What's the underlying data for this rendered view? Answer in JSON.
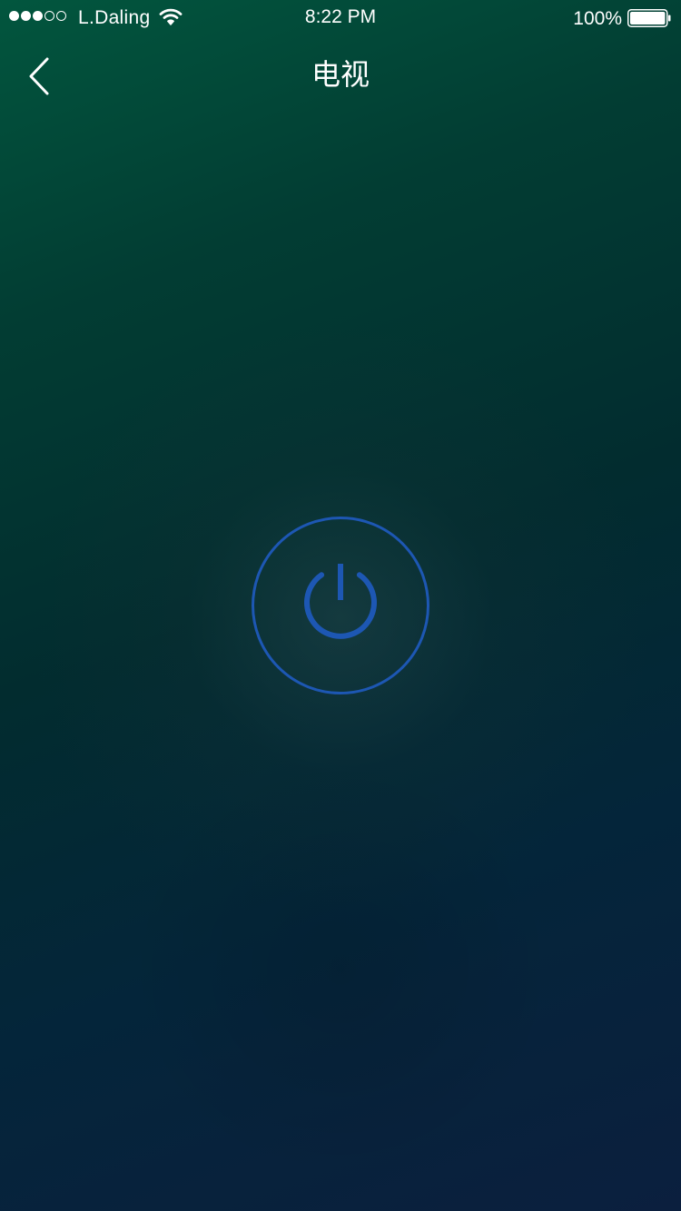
{
  "status_bar": {
    "signal_strength": 3,
    "signal_max": 5,
    "carrier": "L.Daling",
    "time": "8:22 PM",
    "battery_percent": "100%",
    "battery_level": 1.0
  },
  "nav": {
    "back_icon": "chevron-left-icon",
    "title": "电视"
  },
  "control": {
    "power_icon": "power-icon",
    "accent_color": "#1d57b3"
  },
  "colors": {
    "background_top": "#02563e",
    "background_bottom": "#0b1f3e",
    "text": "#ffffff"
  }
}
